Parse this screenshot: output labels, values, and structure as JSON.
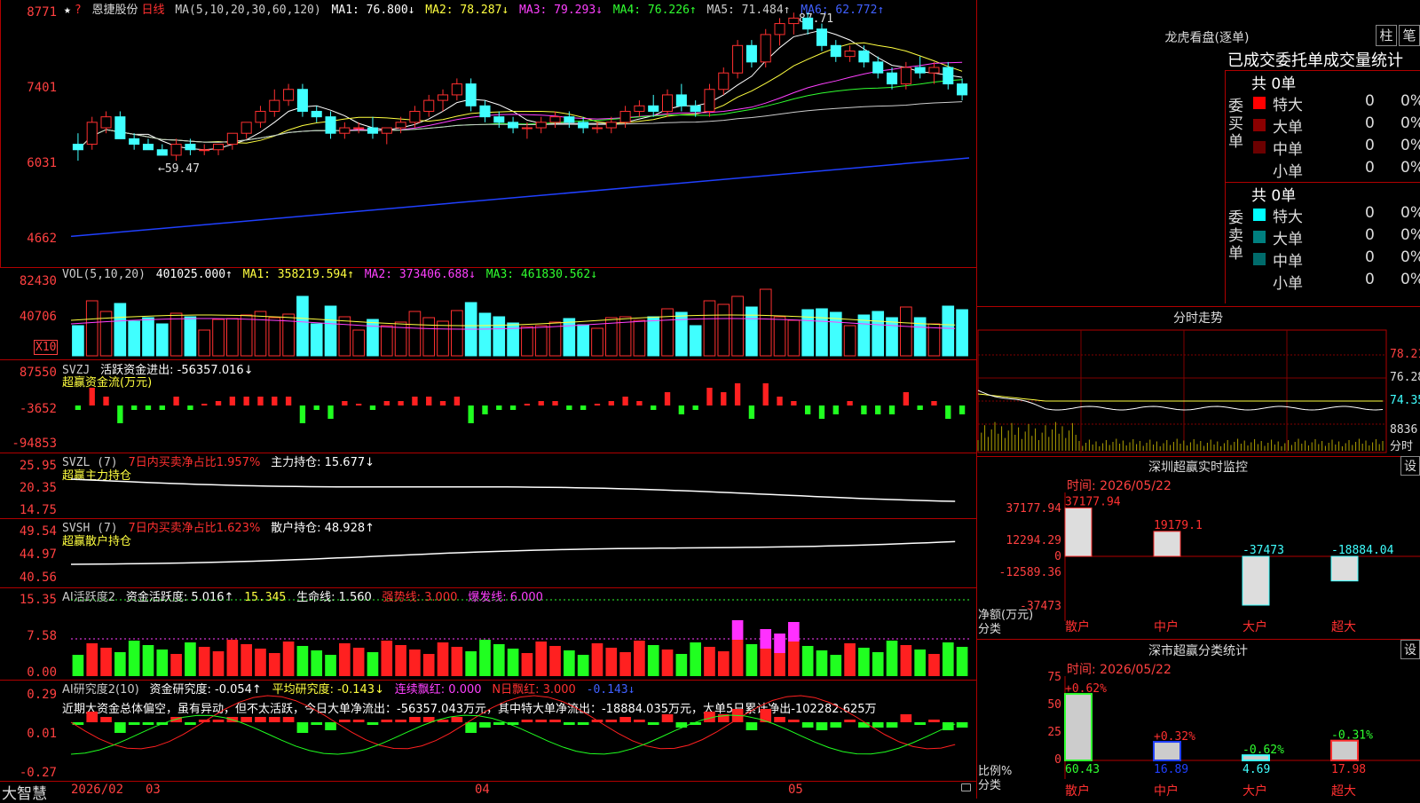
{
  "header": {
    "star": "★",
    "flag": "?",
    "stock_name": "恩捷股份",
    "period": "日线",
    "ma_def": "MA(5,10,20,30,60,120)",
    "ma1": "MA1: 76.800↓",
    "ma2": "MA2: 78.287↓",
    "ma3": "MA3: 79.293↓",
    "ma4": "MA4: 76.226↑",
    "ma5": "MA5: 71.484↑",
    "ma6": "MA6: 62.772↑"
  },
  "price_axis": [
    "8771",
    "7401",
    "6031",
    "4662"
  ],
  "price_annotations": {
    "high": "87.71",
    "low": "←59.47"
  },
  "vol": {
    "title": "VOL(5,10,20)",
    "value": "401025.000↑",
    "ma1": "MA1: 358219.594↑",
    "ma2": "MA2: 373406.688↓",
    "ma3": "MA3: 461830.562↓",
    "axis": [
      "82430",
      "40706"
    ],
    "unit": "X10"
  },
  "svzj": {
    "title": "SVZJ",
    "desc": "活跃资金进出: -56357.016↓",
    "subtitle": "超赢资金流(万元)",
    "axis": [
      "87550",
      "-3652",
      "-94853"
    ]
  },
  "svzl": {
    "title": "SVZL (7)",
    "desc": "7日内买卖净占比1.957%",
    "hold": "主力持仓: 15.677↓",
    "subtitle": "超赢主力持仓",
    "axis": [
      "25.95",
      "20.35",
      "14.75"
    ]
  },
  "svsh": {
    "title": "SVSH (7)",
    "desc": "7日内买卖净占比1.623%",
    "hold": "散户持仓: 48.928↑",
    "subtitle": "超赢散户持仓",
    "axis": [
      "49.54",
      "44.97",
      "40.56"
    ]
  },
  "ai_active": {
    "title": "AI活跃度2",
    "v1": "资金活跃度: 5.016↑",
    "v2": "15.345",
    "v3": "生命线: 1.560",
    "v4": "强势线: 3.000",
    "v5": "爆发线: 6.000",
    "axis": [
      "15.35",
      "7.58",
      "0.00"
    ]
  },
  "ai_research": {
    "title": "AI研究度2(10)",
    "v1": "资金研究度: -0.054↑",
    "v2": "平均研究度: -0.143↓",
    "v3": "连续飘红: 0.000",
    "v4": "N日飘红: 3.000",
    "v5": "-0.143↓",
    "note": "近期大资金总体偏空，虽有异动，但不太活跃，今日大单净流出：-56357.043万元，其中特大单净流出：-18884.035万元，大单5日累计净出-102282.625万",
    "axis": [
      "0.29",
      "0.01",
      "-0.27"
    ]
  },
  "date_axis": {
    "brand": "大智慧",
    "labels": [
      "2026/02",
      "03",
      "04",
      "05"
    ]
  },
  "dragon": {
    "title": "龙虎看盘(逐单)",
    "btn1": "柱",
    "btn2": "笔",
    "subtitle": "已成交委托单成交量统计",
    "buy_label": "委买单",
    "sell_label": "委卖单",
    "buy_total": "共 0单",
    "sell_total": "共 0单",
    "buy_rows": [
      {
        "label": "特大",
        "v": "0",
        "p": "0%",
        "color": "#ff0000"
      },
      {
        "label": "大单",
        "v": "0",
        "p": "0%",
        "color": "#8b0000"
      },
      {
        "label": "中单",
        "v": "0",
        "p": "0%",
        "color": "#6b0000"
      },
      {
        "label": "小单",
        "v": "0",
        "p": "0%",
        "color": "#000000"
      }
    ],
    "sell_rows": [
      {
        "label": "特大",
        "v": "0",
        "p": "0%",
        "color": "#00ffff"
      },
      {
        "label": "大单",
        "v": "0",
        "p": "0%",
        "color": "#008080"
      },
      {
        "label": "中单",
        "v": "0",
        "p": "0%",
        "color": "#006b6b"
      },
      {
        "label": "小单",
        "v": "0",
        "p": "0%",
        "color": "#000000"
      }
    ]
  },
  "intraday": {
    "title": "分时走势",
    "axis": [
      "78.21",
      "76.28",
      "74.35"
    ],
    "vol_label": "8836",
    "unit": "分时"
  },
  "sz_monitor": {
    "title": "深圳超赢实时监控",
    "btn": "设",
    "time": "时间: 2026/05/22",
    "axis": [
      "37177.94",
      "12294.29",
      "0",
      "-12589.36",
      "-37473"
    ],
    "ylabel1": "净额(万元)",
    "ylabel2": "分类",
    "bars": [
      {
        "label": "散户",
        "value": "37177.94",
        "v": 37177.94
      },
      {
        "label": "中户",
        "value": "19179.1",
        "v": 19179.1
      },
      {
        "label": "大户",
        "value": "-37473",
        "v": -37473
      },
      {
        "label": "超大",
        "value": "-18884.04",
        "v": -18884.04
      }
    ]
  },
  "sz_stats": {
    "title": "深市超赢分类统计",
    "btn": "设",
    "time": "时间: 2026/05/22",
    "axis": [
      "75",
      "50",
      "25",
      "0"
    ],
    "ylabel1": "比例%",
    "ylabel2": "分类",
    "bars": [
      {
        "label": "散户",
        "value": "60.43",
        "change": "+0.62%",
        "v": 60.43
      },
      {
        "label": "中户",
        "value": "16.89",
        "change": "+0.32%",
        "v": 16.89
      },
      {
        "label": "大户",
        "value": "4.69",
        "change": "-0.62%",
        "v": 4.69
      },
      {
        "label": "超大",
        "value": "17.98",
        "change": "-0.31%",
        "v": 17.98
      }
    ]
  },
  "chart_data": {
    "type": "candlestick",
    "ylim": [
      46.62,
      87.71
    ],
    "candles": [
      [
        64,
        66,
        61,
        63
      ],
      [
        64,
        69,
        63,
        68
      ],
      [
        67,
        70,
        66,
        69
      ],
      [
        69,
        70,
        65,
        65
      ],
      [
        65,
        66,
        63,
        64
      ],
      [
        64,
        65,
        63,
        63
      ],
      [
        63,
        64,
        62,
        62
      ],
      [
        62,
        65,
        61,
        64
      ],
      [
        64,
        65,
        62,
        63
      ],
      [
        63,
        64,
        62,
        63
      ],
      [
        63,
        64,
        62,
        64
      ],
      [
        64,
        66,
        63,
        66
      ],
      [
        66,
        68,
        65,
        68
      ],
      [
        68,
        71,
        67,
        70
      ],
      [
        70,
        74,
        69,
        72
      ],
      [
        72,
        75,
        71,
        74
      ],
      [
        74,
        75,
        69,
        70
      ],
      [
        70,
        71,
        68,
        69
      ],
      [
        69,
        70,
        65,
        66
      ],
      [
        66,
        68,
        65,
        67
      ],
      [
        67,
        68,
        66,
        67
      ],
      [
        67,
        69,
        65,
        66
      ],
      [
        66,
        67,
        64,
        67
      ],
      [
        67,
        69,
        66,
        68
      ],
      [
        68,
        71,
        67,
        70
      ],
      [
        70,
        73,
        69,
        72
      ],
      [
        72,
        74,
        70,
        73
      ],
      [
        73,
        76,
        72,
        75
      ],
      [
        75,
        76,
        70,
        71
      ],
      [
        71,
        72,
        68,
        69
      ],
      [
        69,
        70,
        67,
        68
      ],
      [
        68,
        69,
        66,
        67
      ],
      [
        67,
        68,
        65,
        67
      ],
      [
        67,
        69,
        66,
        68
      ],
      [
        68,
        70,
        67,
        69
      ],
      [
        69,
        70,
        67,
        68
      ],
      [
        68,
        69,
        66,
        67
      ],
      [
        67,
        68,
        66,
        67
      ],
      [
        67,
        69,
        66,
        68
      ],
      [
        68,
        71,
        67,
        70
      ],
      [
        70,
        72,
        69,
        71
      ],
      [
        71,
        73,
        69,
        70
      ],
      [
        70,
        74,
        69,
        73
      ],
      [
        73,
        75,
        70,
        71
      ],
      [
        71,
        72,
        69,
        70
      ],
      [
        70,
        75,
        69,
        74
      ],
      [
        74,
        78,
        73,
        77
      ],
      [
        77,
        83,
        76,
        82
      ],
      [
        82,
        83,
        78,
        79
      ],
      [
        79,
        85,
        78,
        84
      ],
      [
        84,
        87,
        82,
        86
      ],
      [
        86,
        88,
        84,
        87
      ],
      [
        87,
        88,
        84,
        85
      ],
      [
        85,
        86,
        81,
        82
      ],
      [
        82,
        83,
        79,
        80
      ],
      [
        80,
        82,
        79,
        81
      ],
      [
        81,
        82,
        78,
        79
      ],
      [
        79,
        80,
        76,
        77
      ],
      [
        77,
        78,
        74,
        75
      ],
      [
        75,
        79,
        74,
        78
      ],
      [
        78,
        80,
        76,
        77
      ],
      [
        77,
        79,
        75,
        78
      ],
      [
        78,
        79,
        74,
        75
      ],
      [
        75,
        76,
        72,
        73
      ]
    ]
  }
}
